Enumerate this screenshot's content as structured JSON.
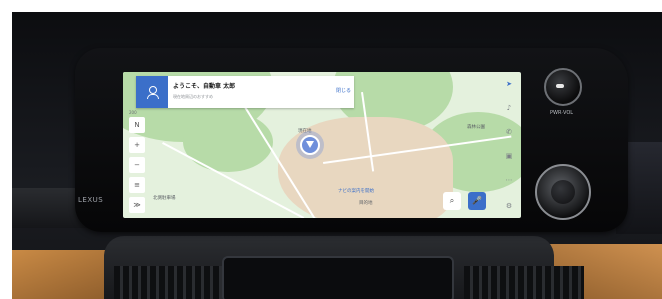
{
  "panel": {
    "greeting": "ようこそ、自動車 太郎",
    "subtitle": "現在地周辺のおすすめ",
    "close_label": "閉じる"
  },
  "map": {
    "scale": "200",
    "place_top_right": "森林公園",
    "place_pin": "現在地",
    "place_left": "北側駐車場",
    "place_bottom": "ナビの案内を開始",
    "place_bottom_sub": "目的地"
  },
  "zoom": {
    "zoom_in": "+",
    "zoom_out": "−",
    "north": "N",
    "layers": "≡",
    "collapse": "≫"
  },
  "icons": {
    "search": "⌕",
    "mic": "🎤",
    "nav": "➤",
    "music": "♪",
    "phone": "✆",
    "car": "▣",
    "apps": "⋯",
    "settings": "⚙"
  },
  "hardware": {
    "brand": "LEXUS",
    "knob_label": "PWR·VOL"
  },
  "colors": {
    "accent": "#3b6fc9",
    "map_green": "#b7dba8",
    "map_base": "#e4f1dd",
    "sand": "#e8d7c0",
    "leather": "#c98a45"
  }
}
